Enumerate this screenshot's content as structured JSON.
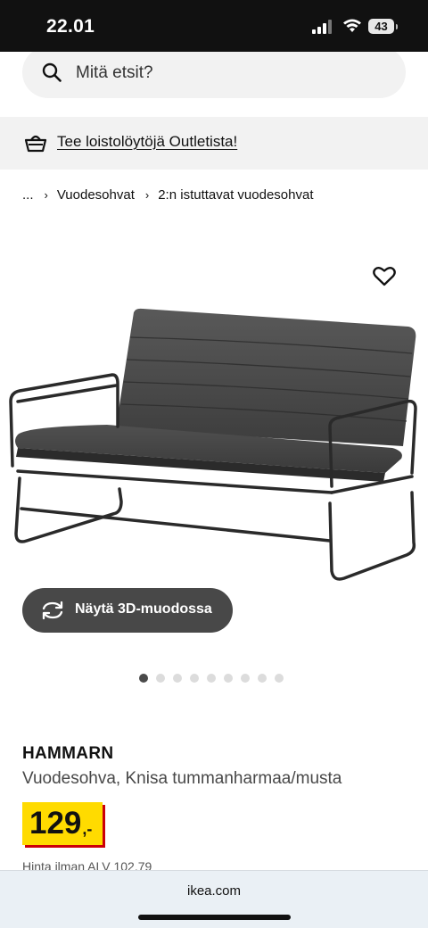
{
  "status_bar": {
    "time": "22.01",
    "battery": "43"
  },
  "search": {
    "placeholder": "Mitä etsit?"
  },
  "banner": {
    "text": "Tee loistolöytöjä Outletista!"
  },
  "breadcrumb": [
    "...",
    "Vuodesohvat",
    "2:n istuttavat vuodesohvat"
  ],
  "gallery": {
    "button_label": "Näytä 3D-muodossa",
    "dot_count": 9,
    "active_index": 0
  },
  "product": {
    "name": "HAMMARN",
    "description": "Vuodesohva, Knisa tummanharmaa/musta",
    "price_main": "129",
    "price_suffix": ",-",
    "vat_text": "Hinta ilman ALV 102,79"
  },
  "browser": {
    "url": "ikea.com"
  },
  "colors": {
    "price_bg": "#ffdb00",
    "price_shadow": "#cc0008",
    "button_bg": "#484848"
  }
}
